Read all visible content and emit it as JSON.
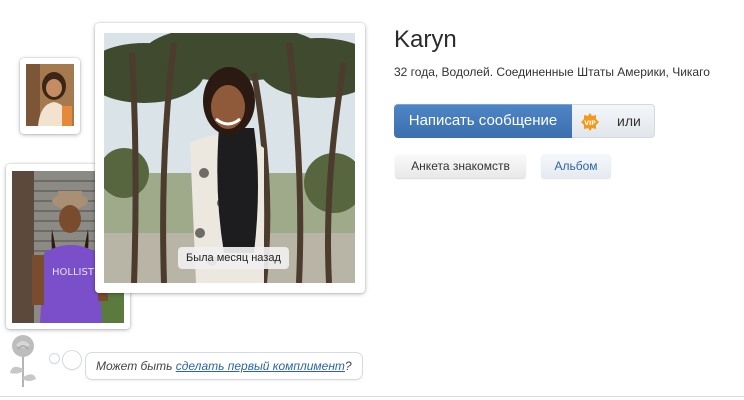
{
  "profile": {
    "name": "Karyn",
    "info": "32 года, Водолей. Соединенные Штаты Америки, Чикаго",
    "last_seen": "Была месяц назад"
  },
  "actions": {
    "message_label": "Написать сообщение",
    "vip_icon": "vip-badge-icon",
    "or_label": "или"
  },
  "tabs": [
    {
      "label": "Анкета знакомств"
    },
    {
      "label": "Альбом"
    }
  ],
  "compliment": {
    "prefix": "Может быть ",
    "link": "сделать первый комплимент",
    "suffix": "?"
  },
  "colors": {
    "accent": "#3b6fae",
    "link": "#2d64a8",
    "vip": "#f39a1e"
  }
}
